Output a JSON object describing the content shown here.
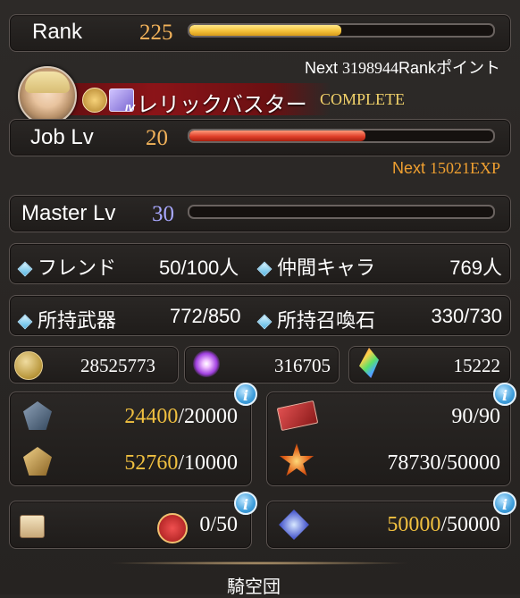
{
  "rank": {
    "label": "Rank",
    "value": "225",
    "progress": 0.5
  },
  "rank_next": {
    "prefix": "Next ",
    "value": "3198944",
    "suffix": "Rankポイント"
  },
  "job": {
    "title": "レリックバスター",
    "status": "COMPLETE",
    "label": "Job Lv",
    "value": "20",
    "progress": 0.58
  },
  "job_next": {
    "prefix": "Next ",
    "value": "15021EXP"
  },
  "master": {
    "label": "Master Lv",
    "value": "30",
    "progress": 0
  },
  "friends": {
    "label": "フレンド",
    "value": "50/100人"
  },
  "crew": {
    "label": "仲間キャラ",
    "value": "769人"
  },
  "weapons": {
    "label": "所持武器",
    "value": "772/850"
  },
  "summons": {
    "label": "所持召喚石",
    "value": "330/730"
  },
  "currency": {
    "rupie": "28525773",
    "crystal": "316705",
    "gem": "15222"
  },
  "stock1": {
    "current": "24400",
    "max": "/20000"
  },
  "stock2": {
    "current": "52760",
    "max": "/10000"
  },
  "ticket": {
    "value": "90/90"
  },
  "burst": {
    "value": "78730/50000"
  },
  "box": {
    "value": "0/50"
  },
  "heart": {
    "current": "50000",
    "max": "/50000"
  },
  "footer": {
    "label": "騎空団"
  },
  "colors": {
    "gold": "#f0c040",
    "orange": "#f0a030",
    "rank_bar": "#f5c23a",
    "job_bar": "#e0402a",
    "master_text": "#a8a8ff"
  }
}
